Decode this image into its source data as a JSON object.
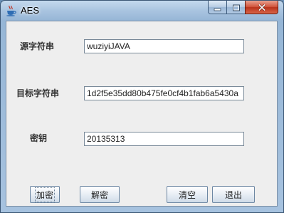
{
  "window": {
    "title": "AES"
  },
  "form": {
    "source_label": "源字符串",
    "source_value": "wuziyiJAVA",
    "target_label": "目标字符串",
    "target_value": "1d2f5e35dd80b475fe0cf4b1fab6a5430a",
    "key_label": "密钥",
    "key_value": "20135313"
  },
  "buttons": {
    "encrypt": "加密",
    "decrypt": "解密",
    "clear": "清空",
    "exit": "退出"
  },
  "icons": {
    "app": "java-coffee-cup-icon",
    "minimize": "minimize-icon",
    "maximize": "maximize-icon",
    "close": "close-icon"
  },
  "colors": {
    "title_bar": "#a9c4e0",
    "close_button": "#c9452c",
    "client_background": "#eeeeee"
  }
}
